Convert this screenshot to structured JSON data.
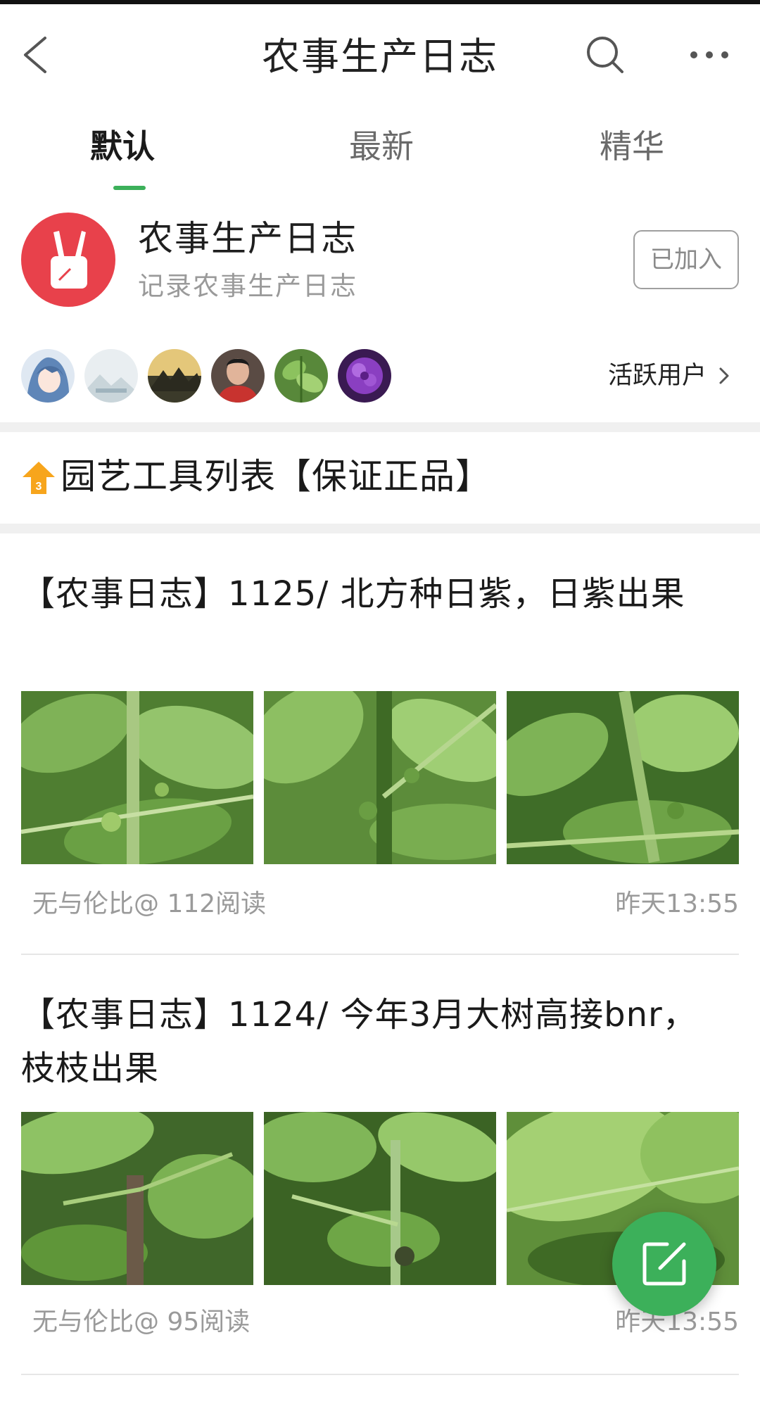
{
  "theme": {
    "accent": "#3cb05a",
    "group_avatar_bg": "#e8414b",
    "separator": "#f0f0f0"
  },
  "header": {
    "title": "农事生产日志",
    "back_icon": "chevron-left-icon",
    "search_icon": "search-icon",
    "more_icon": "more-horizontal-icon"
  },
  "tabs": [
    {
      "label": "默认",
      "active": true
    },
    {
      "label": "最新",
      "active": false
    },
    {
      "label": "精华",
      "active": false
    }
  ],
  "group": {
    "name": "农事生产日志",
    "description": "记录农事生产日志",
    "join_status": "已加入"
  },
  "members": {
    "active_users_label": "活跃用户",
    "count_shown": 6
  },
  "pinned": {
    "badge": "3",
    "title": "园艺工具列表【保证正品】"
  },
  "posts": [
    {
      "title": "【农事日志】1125/ 北方种日紫，日紫出果",
      "meta": "无与伦比@ 112阅读",
      "time": "昨天13:55"
    },
    {
      "title": "【农事日志】1124/ 今年3月大树高接bnr，枝枝出果",
      "meta": "无与伦比@ 95阅读",
      "time": "昨天13:55"
    }
  ],
  "fab": {
    "icon": "edit-icon"
  }
}
